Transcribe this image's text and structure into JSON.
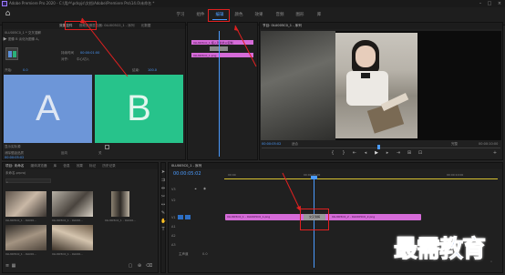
{
  "titlebar": {
    "text": "Adobe Premiere Pro 2020 - C:\\用户\\pdsyjs\\文档\\Adobe\\Premiere Pro\\14.0\\未命名 *"
  },
  "workspaces": [
    "学习",
    "组件",
    "编辑",
    "颜色",
    "效果",
    "音频",
    "图形",
    "库"
  ],
  "workspace_active_index": 2,
  "effect_controls": {
    "tabs": [
      "效果控件",
      "音频剪辑混合器: 0LU005C0_1 - 序列",
      "元数据"
    ],
    "source_label": "主要 * 0LU005C0_1.png",
    "clip_label": "0LU005C0_1 * 交叉溶解",
    "description": "图像 B 淡化为图像 A。",
    "duration_label": "持续时间",
    "duration_value": "00:00:01:00",
    "align_label": "对齐:",
    "align_value": "中心切入",
    "start_label": "开始:",
    "start_value": "0.0",
    "end_label": "结束:",
    "end_value": "100.0",
    "preview_a": "A",
    "preview_b": "B",
    "show_actual_label": "显示实际源",
    "reverse_label": "反向",
    "antialias_label": "消除锯齿品质",
    "antialias_value": "关",
    "timecode": "00:00:05:02"
  },
  "mini_timeline": {
    "clip1": "0LU005C0_1 拖入到此处以复制",
    "clip2": "0LU005C0_1.png"
  },
  "program_monitor": {
    "tab": "节目: 0LU005C0_1 - 序列",
    "timecode": "00:00:05:02",
    "fit": "完整",
    "duration": "00:00:10:00",
    "fit_option": "适合"
  },
  "project": {
    "tabs": [
      "项目: 未命名",
      "媒体浏览器",
      "库",
      "信息",
      "效果",
      "标记",
      "历史记录"
    ],
    "project_name": "未命名.prproj",
    "search_placeholder": "",
    "item_count": "",
    "items": [
      {
        "name": "0LU005C0_1 - 0LU00...",
        "dur": "5:00"
      },
      {
        "name": "0LU005C0_1 - 0LU00...",
        "dur": "5:00"
      },
      {
        "name": "0LU005C0_1 - 0LU00...",
        "dur": "5:00"
      },
      {
        "name": "0LU005C0_1 - 0LU00...",
        "dur": "5:00"
      },
      {
        "name": "0LU005C0_1 - 0LU00...",
        "dur": "5:00"
      }
    ]
  },
  "timeline": {
    "tab": "0LU005C0_1 - 序列",
    "timecode": "00:00:05:02",
    "ruler": [
      "00:00",
      "00:00:05:00",
      "00:00:10:00"
    ],
    "tracks": [
      "V3",
      "V2",
      "V1",
      "A1",
      "A2",
      "A3",
      "主声道"
    ],
    "clip_a": "0LU005C0_1 - 0LU005C0_1.png",
    "clip_b": "0LU005C0_2 - 0LU005C0_2.png",
    "transition": "交叉溶解",
    "master_value": "0.0"
  },
  "watermark": "最需教育",
  "colors": {
    "accent": "#4b9bff",
    "clip": "#d56bd8",
    "red_box": "#e02020",
    "preview_a": "#6d96d8",
    "preview_b": "#27c38b"
  }
}
